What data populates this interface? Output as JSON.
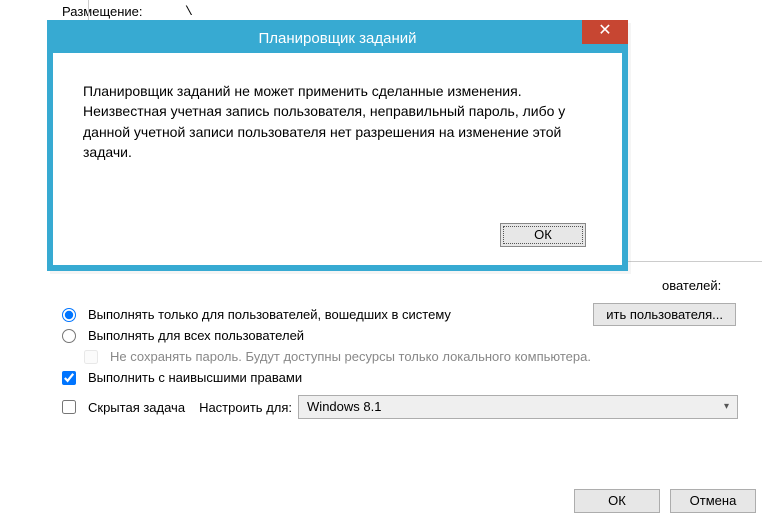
{
  "main": {
    "location_label": "Размещение:",
    "location_value": "\\",
    "user_suffix": "ователей:",
    "change_user_btn": "ить пользователя...",
    "radio_logged": "Выполнять только для пользователей, вошедших в систему",
    "radio_all": "Выполнять для всех пользователей",
    "no_save_pw": "Не сохранять пароль. Будут доступны ресурсы только локального компьютера.",
    "highest_priv": "Выполнить с наивысшими правами",
    "hidden_task": "Скрытая задача",
    "configure_for_label": "Настроить для:",
    "configure_for_value": "Windows 8.1",
    "ok": "ОК",
    "cancel": "Отмена"
  },
  "dialog": {
    "title": "Планировщик заданий",
    "message": "Планировщик заданий не может применить сделанные изменения. Неизвестная учетная запись пользователя, неправильный пароль, либо у данной учетной записи пользователя нет разрешения на изменение этой задачи.",
    "ok": "ОК",
    "close_glyph": "✕"
  }
}
